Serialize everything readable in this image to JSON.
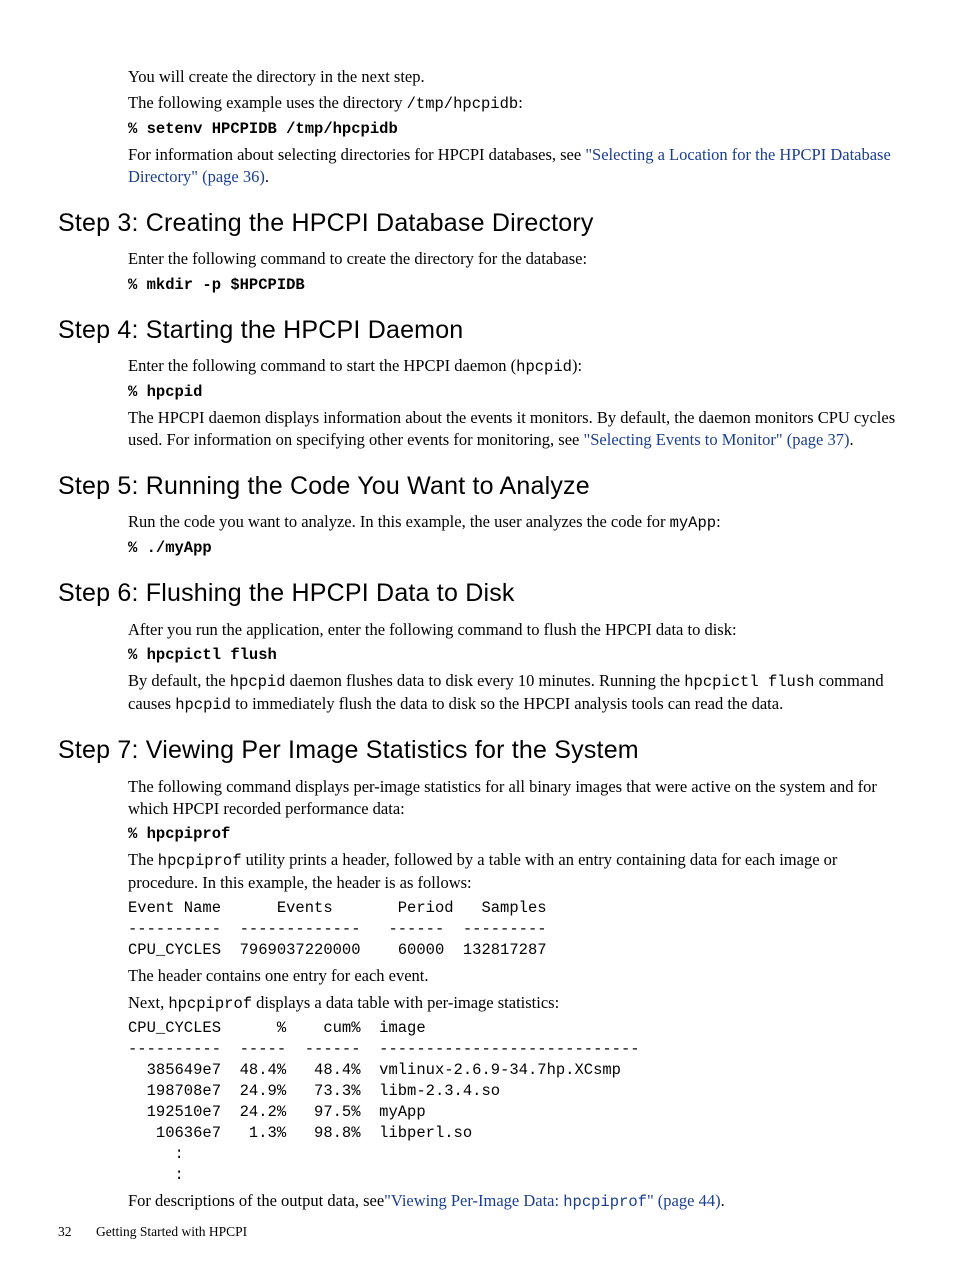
{
  "intro": {
    "p1": "You will create the directory in the next step.",
    "p2a": "The following example uses the directory ",
    "p2b": "/tmp/hpcpidb",
    "p2c": ":",
    "cmd": "% setenv HPCPIDB /tmp/hpcpidb",
    "p3a": "For information about selecting directories for HPCPI databases, see ",
    "link": "\"Selecting a Location for the HPCPI Database Directory\" (page 36)",
    "p3b": "."
  },
  "step3": {
    "title": "Step 3: Creating the HPCPI Database Directory",
    "p1": "Enter the following command to create the directory for the database:",
    "cmd": "% mkdir -p $HPCPIDB"
  },
  "step4": {
    "title": "Step 4: Starting the HPCPI Daemon",
    "p1a": "Enter the following command to start the HPCPI daemon (",
    "p1b": "hpcpid",
    "p1c": "):",
    "cmd": "% hpcpid",
    "p2a": "The HPCPI daemon displays information about the events it monitors. By default, the daemon monitors CPU cycles used. For information on specifying other events for monitoring, see ",
    "link": "\"Selecting Events to Monitor\" (page 37)",
    "p2b": "."
  },
  "step5": {
    "title": "Step 5: Running the Code You Want to Analyze",
    "p1a": "Run the code you want to analyze. In this example, the user analyzes the code for ",
    "p1b": "myApp",
    "p1c": ":",
    "cmd": "% ./myApp"
  },
  "step6": {
    "title": "Step 6: Flushing the HPCPI Data to Disk",
    "p1": "After you run the application, enter the following command to flush the HPCPI data to disk:",
    "cmd": "% hpcpictl flush",
    "p2a": "By default, the ",
    "p2b": "hpcpid",
    "p2c": " daemon flushes data to disk every 10 minutes. Running the ",
    "p2d": "hpcpictl flush",
    "p2e": " command causes ",
    "p2f": "hpcpid",
    "p2g": " to immediately flush the data to disk so the HPCPI analysis tools can read the data."
  },
  "step7": {
    "title": "Step 7: Viewing Per Image Statistics for the System",
    "p1": "The following command displays per-image statistics for all binary images that were active on the system and for which HPCPI recorded performance data:",
    "cmd": "% hpcpiprof",
    "p2a": "The ",
    "p2b": "hpcpiprof",
    "p2c": " utility prints a header, followed by a table with an entry containing data for each image or procedure. In this example, the header is as follows:",
    "pre1": "Event Name      Events       Period   Samples\n----------  -------------   ------  ---------\nCPU_CYCLES  7969037220000    60000  132817287",
    "p3": "The header contains one entry for each event.",
    "p4a": "Next, ",
    "p4b": "hpcpiprof",
    "p4c": " displays a data table with per-image statistics:",
    "pre2": "CPU_CYCLES      %    cum%  image\n----------  -----  ------  ----------------------------\n  385649e7  48.4%   48.4%  vmlinux-2.6.9-34.7hp.XCsmp\n  198708e7  24.9%   73.3%  libm-2.3.4.so\n  192510e7  24.2%   97.5%  myApp\n   10636e7   1.3%   98.8%  libperl.so\n     :\n     :",
    "p5a": "For descriptions of the output data, see",
    "link1": "\"Viewing Per-Image Data: ",
    "link2": "hpcpiprof",
    "link3": "\" (page 44)",
    "p5b": "."
  },
  "footer": {
    "page": "32",
    "text": "Getting Started with HPCPI"
  }
}
